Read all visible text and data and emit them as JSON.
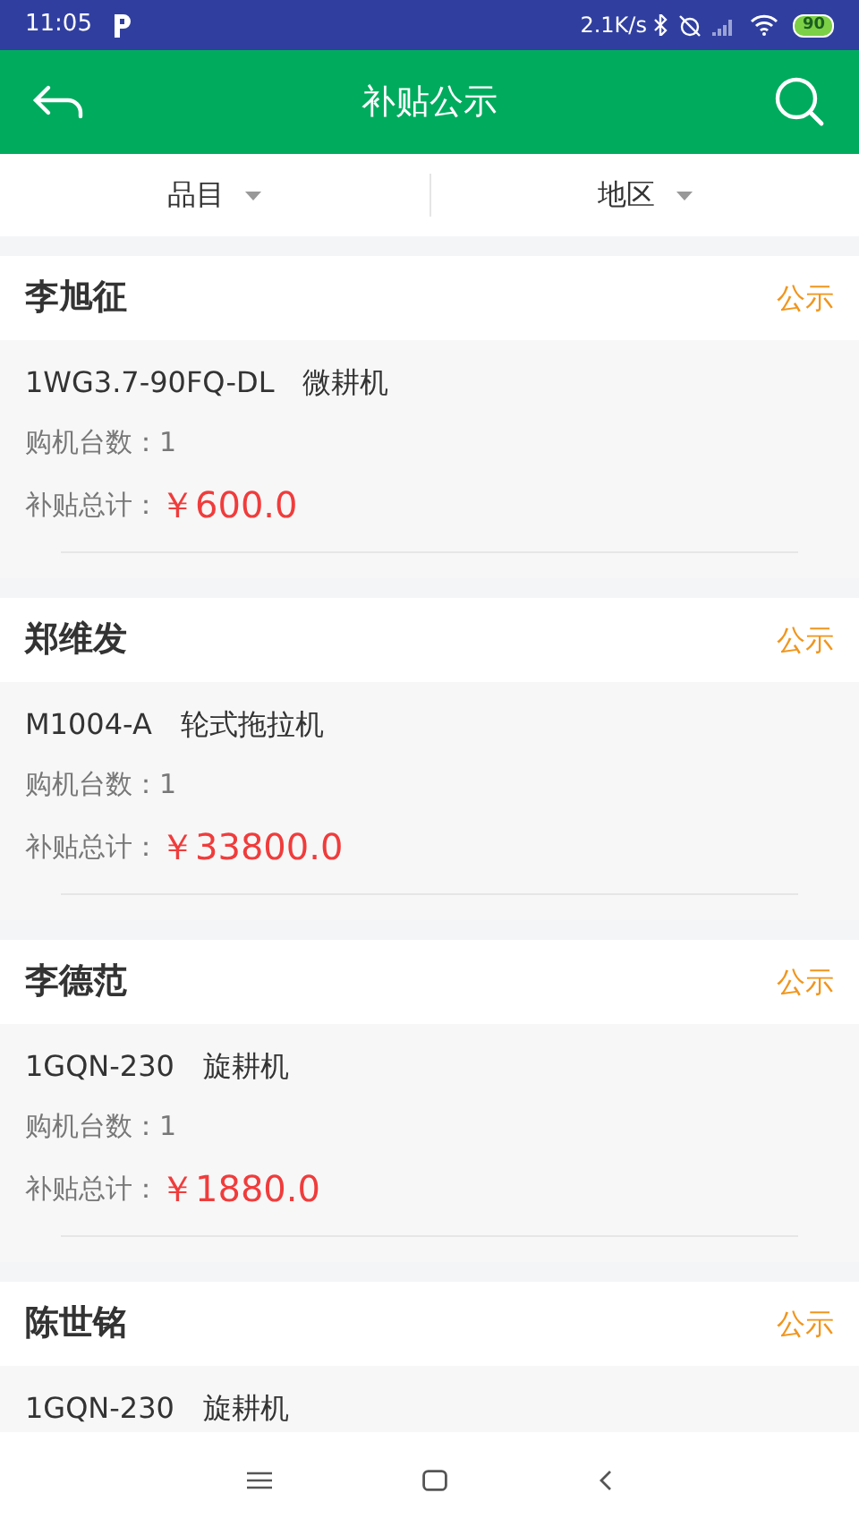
{
  "status_bar": {
    "time": "11:05",
    "speed": "2.1K/s",
    "battery": "90"
  },
  "header": {
    "title": "补贴公示"
  },
  "filters": [
    {
      "label": "品目"
    },
    {
      "label": "地区"
    }
  ],
  "records": [
    {
      "name": "李旭征",
      "status": "公示",
      "model": "1WG3.7-90FQ-DL",
      "machine": "微耕机",
      "count": "购机台数：1",
      "total_label": "补贴总计：",
      "total": "￥600.0"
    },
    {
      "name": "郑维发",
      "status": "公示",
      "model": "M1004-A",
      "machine": "轮式拖拉机",
      "count": "购机台数：1",
      "total_label": "补贴总计：",
      "total": "￥33800.0"
    },
    {
      "name": "李德范",
      "status": "公示",
      "model": "1GQN-230",
      "machine": "旋耕机",
      "count": "购机台数：1",
      "total_label": "补贴总计：",
      "total": "￥1880.0"
    },
    {
      "name": "陈世铭",
      "status": "公示",
      "model": "1GQN-230",
      "machine": "旋耕机"
    }
  ]
}
